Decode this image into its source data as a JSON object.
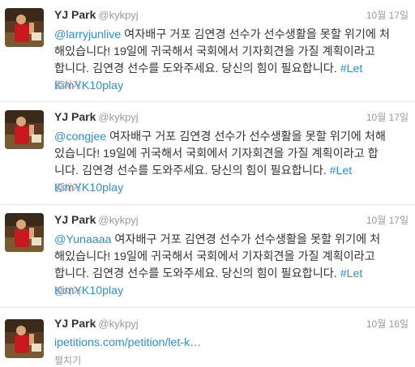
{
  "colors": {
    "link": "#2b8fd6",
    "meta": "#999999",
    "text": "#333333"
  },
  "tweets": [
    {
      "name": "YJ Park",
      "handle": "@kykpyj",
      "time": "10월 17일",
      "lines": [
        {
          "mention": "@larryjunlive",
          "text": " 여자배구 거포 김연경 선수가 선수생활을 못할 위기에 처"
        },
        {
          "text": "해있습니다! 19일에 귀국해서 국회에서 기자회견을 가질 계획이라고"
        },
        {
          "text": "합니다. 김연경 선수를 도와주세요. 당신의 힘이 필요합니다. ",
          "hashtag": "#Let"
        },
        {
          "hashtag_tail": "KimYK10play"
        }
      ],
      "expand": "펼치기"
    },
    {
      "name": "YJ Park",
      "handle": "@kykpyj",
      "time": "10월 17일",
      "lines": [
        {
          "mention": "@congjee",
          "text": " 여자배구 거포 김연경 선수가 선수생활을 못할 위기에 처해"
        },
        {
          "text": "있습니다! 19일에 귀국해서 국회에서 기자회견을 가질 계획이라고 합"
        },
        {
          "text": "니다. 김연경 선수를 도와주세요. 당신의 힘이 필요합니다. ",
          "hashtag": "#Let"
        },
        {
          "hashtag_tail": "KimYK10play"
        }
      ],
      "expand": "펼치기"
    },
    {
      "name": "YJ Park",
      "handle": "@kykpyj",
      "time": "10월 17일",
      "lines": [
        {
          "mention": "@Yunaaaa",
          "text": " 여자배구 거포 김연경 선수가 선수생활을 못할 위기에 처"
        },
        {
          "text": "해있습니다! 19일에 귀국해서 국회에서 기자회견을 가질 계획이라고"
        },
        {
          "text": "합니다. 김연경 선수를 도와주세요. 당신의 힘이 필요합니다. ",
          "hashtag": "#Let"
        },
        {
          "hashtag_tail": "KimYK10play"
        }
      ],
      "expand": "펼치기"
    },
    {
      "name": "YJ Park",
      "handle": "@kykpyj",
      "time": "10월 16일",
      "lines": [
        {
          "link": "ipetitions.com/petition/let-k…"
        }
      ],
      "expand": "펼치기"
    }
  ]
}
